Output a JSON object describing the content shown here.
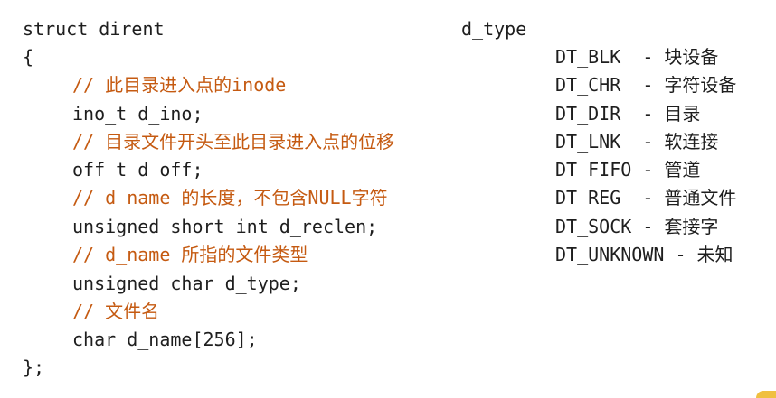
{
  "code": {
    "lines": [
      "struct dirent",
      "{",
      "// 此目录进入点的inode",
      "ino_t d_ino;",
      "// 目录文件开头至此目录进入点的位移",
      "off_t d_off;",
      "// d_name 的长度，不包含NULL字符",
      "unsigned short int d_reclen;",
      "// d_name 所指的文件类型",
      "unsigned char d_type;",
      "// 文件名",
      "char d_name[256];",
      "};"
    ]
  },
  "types": {
    "header": "d_type",
    "entries": [
      "DT_BLK  - 块设备",
      "DT_CHR  - 字符设备",
      "DT_DIR  - 目录",
      "DT_LNK  - 软连接",
      "DT_FIFO - 管道",
      "DT_REG  - 普通文件",
      "DT_SOCK - 套接字",
      "DT_UNKNOWN - 未知"
    ]
  },
  "colors": {
    "code_text": "#1e1e1e",
    "comment_text": "#c55a11",
    "background": "#ffffff",
    "corner_accent": "#f0c040"
  }
}
